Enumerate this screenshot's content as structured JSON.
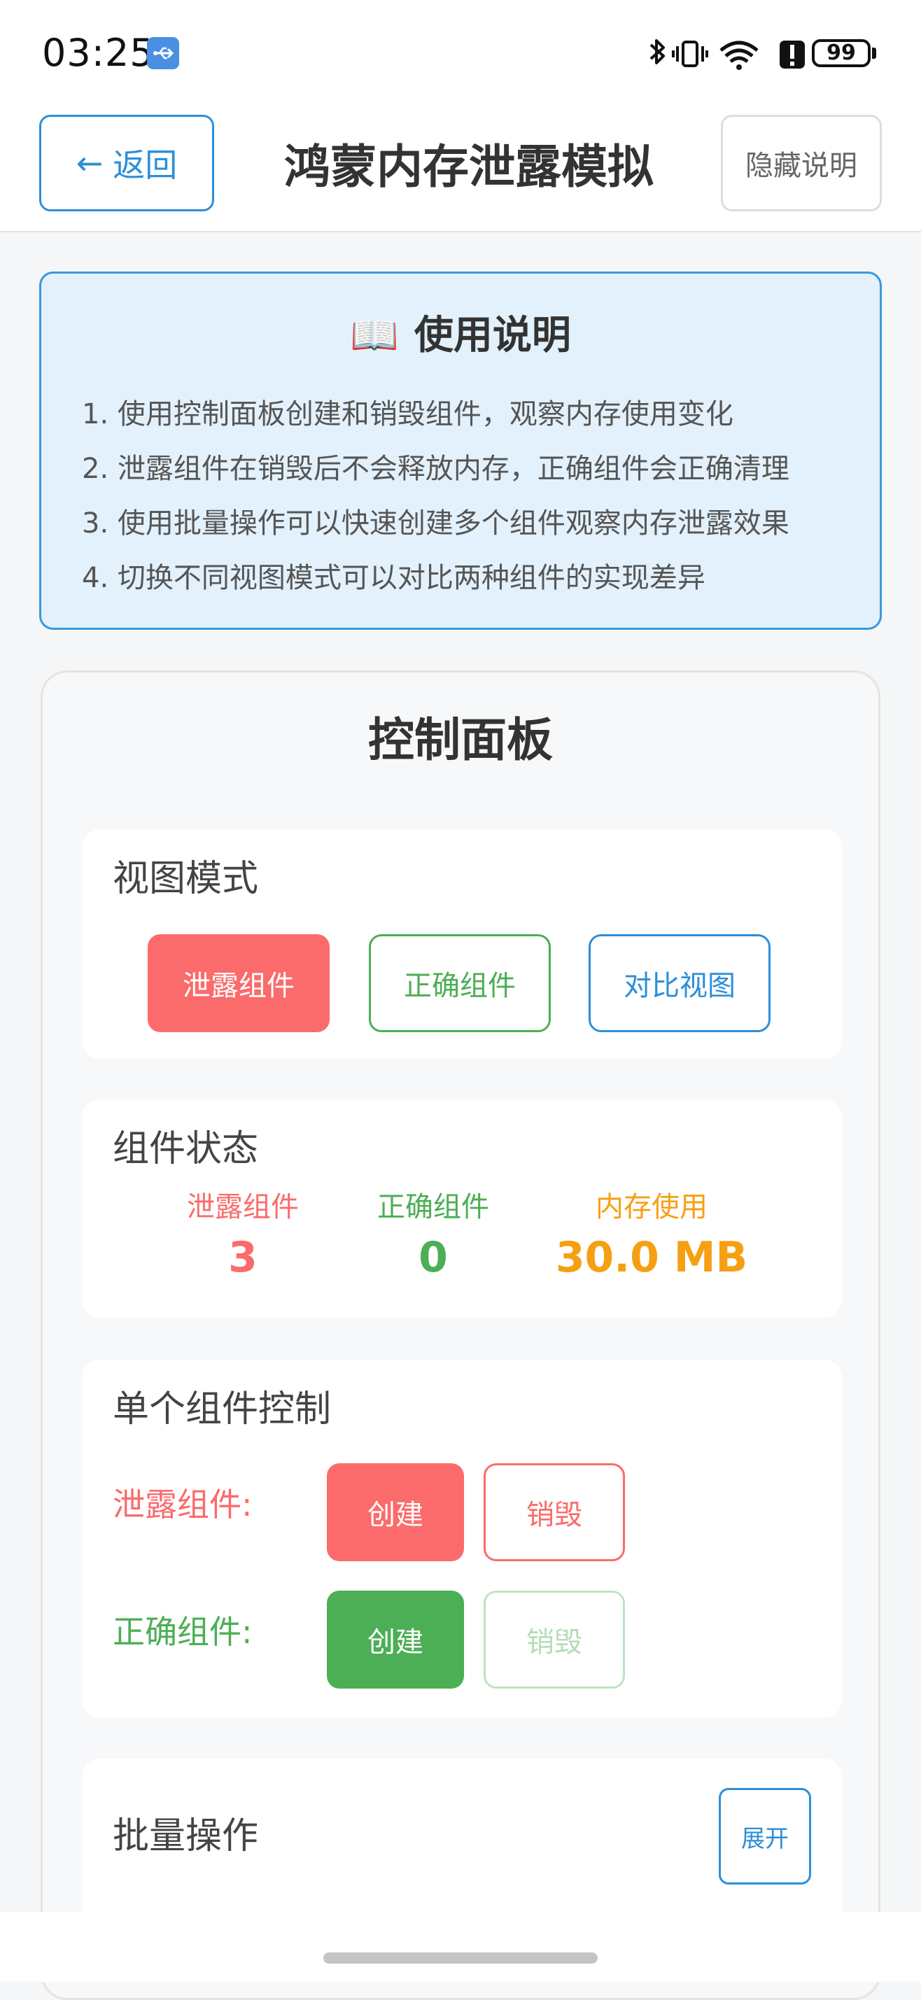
{
  "status_bar": {
    "time": "03:25",
    "battery": "99",
    "icons": [
      "usb-icon",
      "bluetooth-icon",
      "vibrate-icon",
      "wifi-icon",
      "alert-icon",
      "battery-icon"
    ]
  },
  "header": {
    "back_label": "返回",
    "back_arrow": "←",
    "title": "鸿蒙内存泄露模拟",
    "hide_label": "隐藏说明"
  },
  "instructions": {
    "icon": "📖",
    "title": "使用说明",
    "items": [
      "1. 使用控制面板创建和销毁组件，观察内存使用变化",
      "2. 泄露组件在销毁后不会释放内存，正确组件会正确清理",
      "3. 使用批量操作可以快速创建多个组件观察内存泄露效果",
      "4. 切换不同视图模式可以对比两种组件的实现差异"
    ]
  },
  "panel": {
    "title": "控制面板",
    "view_mode": {
      "title": "视图模式",
      "options": [
        "泄露组件",
        "正确组件",
        "对比视图"
      ],
      "selected": "泄露组件"
    },
    "status": {
      "title": "组件状态",
      "leak_label": "泄露组件",
      "leak_value": "3",
      "correct_label": "正确组件",
      "correct_value": "0",
      "memory_label": "内存使用",
      "memory_value": "30.0 MB"
    },
    "single": {
      "title": "单个组件控制",
      "leak_label": "泄露组件:",
      "correct_label": "正确组件:",
      "create": "创建",
      "destroy": "销毁"
    },
    "batch": {
      "title": "批量操作",
      "expand": "展开"
    }
  },
  "colors": {
    "leak": "#fb6b6b",
    "correct": "#4cae55",
    "accent": "#2d8fd8",
    "memory": "#f5a013"
  }
}
